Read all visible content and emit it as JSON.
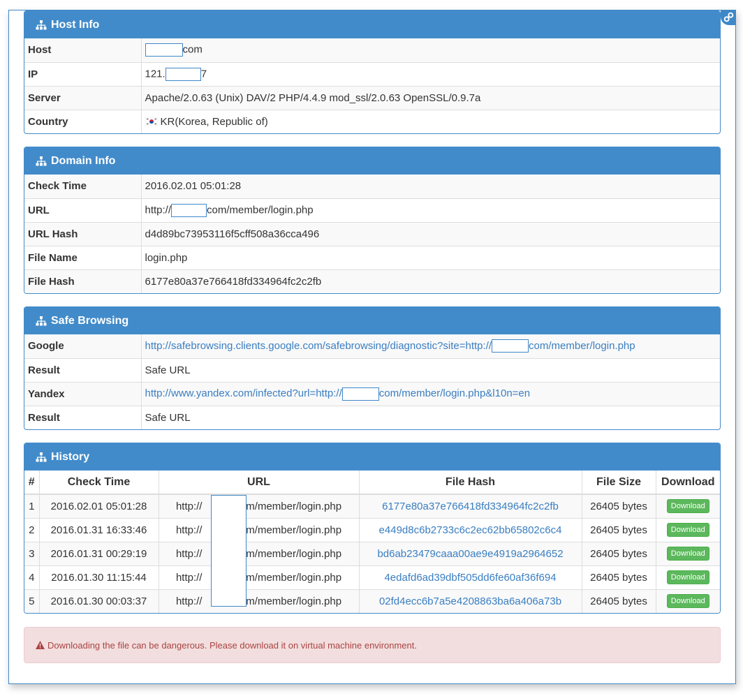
{
  "host_info": {
    "title": "Host Info",
    "rows": [
      {
        "key": "Host",
        "pre": "",
        "post": "com"
      },
      {
        "key": "IP",
        "pre": "121.",
        "post": "7"
      },
      {
        "key": "Server",
        "value": "Apache/2.0.63 (Unix) DAV/2 PHP/4.4.9 mod_ssl/2.0.63 OpenSSL/0.9.7a"
      },
      {
        "key": "Country",
        "value": "KR(Korea, Republic of)"
      }
    ]
  },
  "domain_info": {
    "title": "Domain Info",
    "rows": [
      {
        "key": "Check Time",
        "value": "2016.02.01 05:01:28"
      },
      {
        "key": "URL",
        "pre": "http://",
        "post": "com/member/login.php"
      },
      {
        "key": "URL Hash",
        "value": "d4d89bc73953116f5cff508a36cca496"
      },
      {
        "key": "File Name",
        "value": "login.php"
      },
      {
        "key": "File Hash",
        "value": "6177e80a37e766418fd334964fc2c2fb"
      }
    ]
  },
  "safe_browsing": {
    "title": "Safe Browsing",
    "rows": [
      {
        "key": "Google",
        "pre": "http://safebrowsing.clients.google.com/safebrowsing/diagnostic?site=http://",
        "post": "com/member/login.php"
      },
      {
        "key": "Result",
        "value": "Safe URL"
      },
      {
        "key": "Yandex",
        "pre": "http://www.yandex.com/infected?url=http://",
        "post": "com/member/login.php&l10n=en"
      },
      {
        "key": "Result",
        "value": "Safe URL"
      }
    ]
  },
  "history": {
    "title": "History",
    "columns": [
      "#",
      "Check Time",
      "URL",
      "File Hash",
      "File Size",
      "Download"
    ],
    "rows": [
      {
        "n": "1",
        "time": "2016.02.01 05:01:28",
        "url_pre": "http://",
        "url_post": "com/member/login.php",
        "hash": "6177e80a37e766418fd334964fc2c2fb",
        "size": "26405 bytes",
        "download": "Download"
      },
      {
        "n": "2",
        "time": "2016.01.31 16:33:46",
        "url_pre": "http://",
        "url_post": "com/member/login.php",
        "hash": "e449d8c6b2733c6c2ec62bb65802c6c4",
        "size": "26405 bytes",
        "download": "Download"
      },
      {
        "n": "3",
        "time": "2016.01.31 00:29:19",
        "url_pre": "http://",
        "url_post": "com/member/login.php",
        "hash": "bd6ab23479caaa00ae9e4919a2964652",
        "size": "26405 bytes",
        "download": "Download"
      },
      {
        "n": "4",
        "time": "2016.01.30 11:15:44",
        "url_pre": "http://",
        "url_post": "com/member/login.php",
        "hash": "4edafd6ad39dbf505dd6fe60af36f694",
        "size": "26405 bytes",
        "download": "Download"
      },
      {
        "n": "5",
        "time": "2016.01.30 00:03:37",
        "url_pre": "http://",
        "url_post": "com/member/login.php",
        "hash": "02fd4ecc6b7a5e4208863ba6a406a73b",
        "size": "26405 bytes",
        "download": "Download"
      }
    ]
  },
  "alert": {
    "text": "Downloading the file can be dangerous. Please download it on virtual machine environment."
  },
  "colors": {
    "primary": "#428bca",
    "link": "#3a7ec1",
    "success": "#5cb85c",
    "danger_bg": "#f2dede",
    "danger_text": "#a94442"
  },
  "icons": {
    "panel_heading": "sitemap-icon",
    "corner": "link-icon",
    "country_flag": "korea-flag-icon",
    "alert": "warning-icon"
  }
}
